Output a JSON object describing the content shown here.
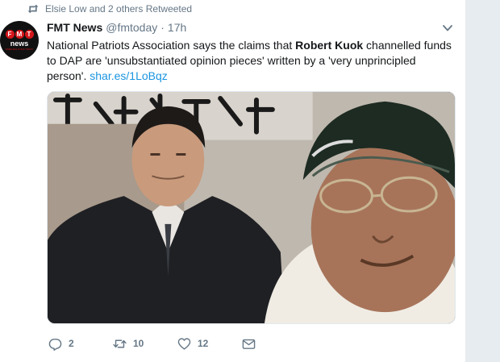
{
  "retweet_context": {
    "text": "Elsie Low and 2 others Retweeted"
  },
  "author": {
    "name": "FMT News",
    "handle": "@fmtoday",
    "separator": "·",
    "time": "17h",
    "avatar_logo": {
      "letters": [
        "F",
        "M",
        "T"
      ],
      "word": "news",
      "tagline": "FREE MALAYSIA TODAY"
    }
  },
  "tweet": {
    "text_before": "National Patriots Association says the claims that ",
    "text_bold": "Robert Kuok",
    "text_after": " channelled funds to DAP are 'unsubstantiated opinion pieces' written by a 'very unprincipled person'. ",
    "link": "shar.es/1LoBqz"
  },
  "actions": {
    "reply_count": "2",
    "retweet_count": "10",
    "like_count": "12"
  },
  "icons": {
    "retweet_context": "retweet-icon",
    "caret": "chevron-down-icon",
    "reply": "reply-icon",
    "retweet": "retweet-icon",
    "like": "heart-icon",
    "message": "envelope-icon"
  },
  "colors": {
    "text": "#14171a",
    "secondary": "#657786",
    "link": "#1b95e0",
    "brand_red": "#d4161b",
    "gutter": "#e6ecf0"
  }
}
